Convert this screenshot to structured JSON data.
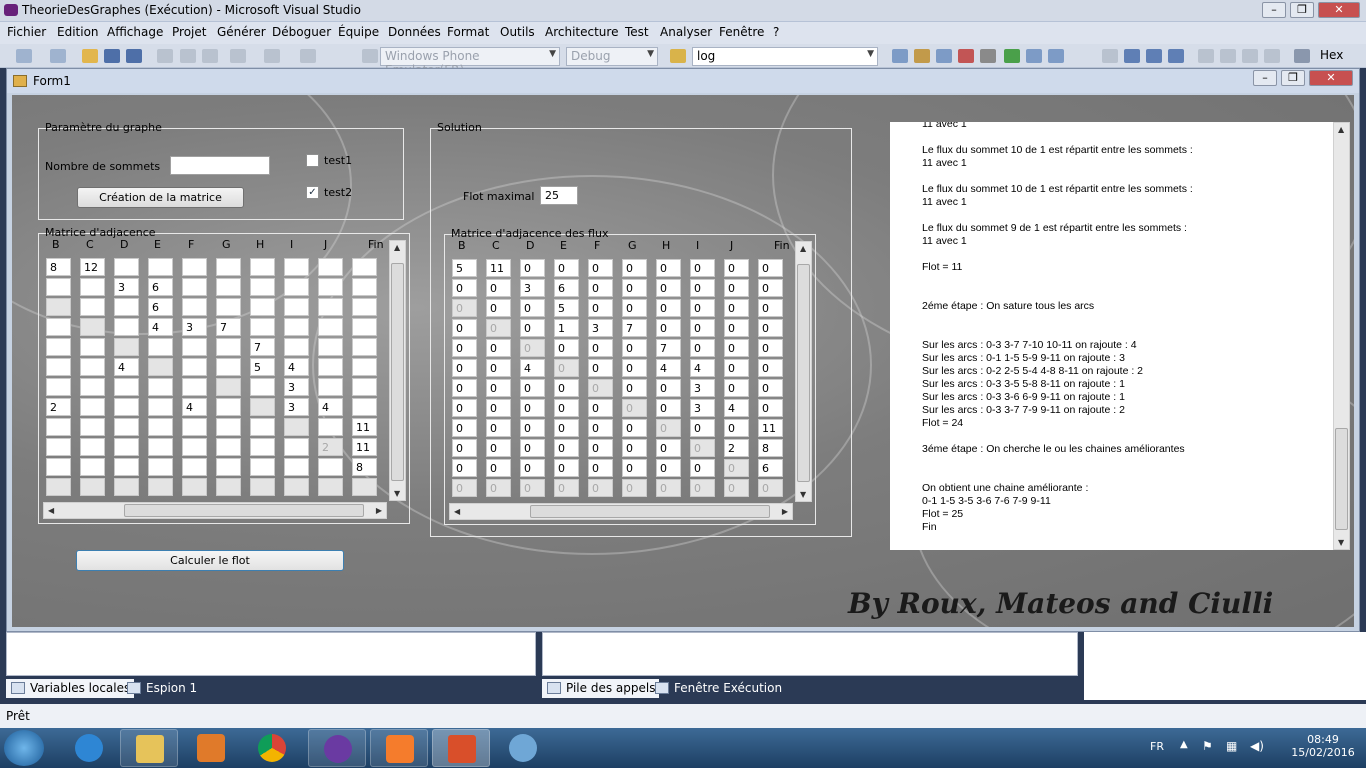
{
  "vs": {
    "title": "TheorieDesGraphes (Exécution) - Microsoft Visual Studio",
    "menu": [
      "Fichier",
      "Edition",
      "Affichage",
      "Projet",
      "Générer",
      "Déboguer",
      "Équipe",
      "Données",
      "Format",
      "Outils",
      "Architecture",
      "Test",
      "Analyser",
      "Fenêtre",
      "?"
    ],
    "emulator": "Windows Phone Emulator(FR)",
    "config": "Debug",
    "find": "log",
    "hex": "Hex"
  },
  "form": {
    "title": "Form1",
    "params": {
      "label": "Paramètre du graphe",
      "sommets_label": "Nombre de sommets",
      "sommets_value": "",
      "button": "Création de la matrice",
      "test1": "test1",
      "test2": "test2",
      "test1_checked": false,
      "test2_checked": true
    },
    "adj": {
      "label": "Matrice d'adjacence",
      "cols": [
        "B",
        "C",
        "D",
        "E",
        "F",
        "G",
        "H",
        "I",
        "J",
        "Fin"
      ],
      "rows": [
        [
          "8",
          "12",
          "",
          "",
          "",
          "",
          "",
          "",
          "",
          ""
        ],
        [
          "",
          "",
          "3",
          "6",
          "",
          "",
          "",
          "",
          "",
          ""
        ],
        [
          "",
          "",
          "",
          "6",
          "",
          "",
          "",
          "",
          "",
          ""
        ],
        [
          "",
          "",
          "",
          "4",
          "3",
          "7",
          "",
          "",
          "",
          ""
        ],
        [
          "",
          "",
          "",
          "",
          "",
          "",
          "7",
          "",
          "",
          ""
        ],
        [
          "",
          "",
          "4",
          "",
          "",
          "",
          "5",
          "4",
          "",
          ""
        ],
        [
          "",
          "",
          "",
          "",
          "",
          "",
          "",
          "3",
          "",
          ""
        ],
        [
          "2",
          "",
          "",
          "",
          "4",
          "",
          "",
          "3",
          "4",
          ""
        ],
        [
          "",
          "",
          "",
          "",
          "",
          "",
          "",
          "",
          "",
          "11"
        ],
        [
          "",
          "",
          "",
          "",
          "",
          "",
          "",
          "",
          "2",
          "11"
        ],
        [
          "",
          "",
          "",
          "",
          "",
          "",
          "",
          "",
          "",
          "8"
        ],
        [
          "",
          "",
          "",
          "",
          "",
          "",
          "",
          "",
          "",
          ""
        ]
      ],
      "disabled": [
        [
          2,
          0
        ],
        [
          3,
          1
        ],
        [
          4,
          2
        ],
        [
          5,
          3
        ],
        [
          6,
          5
        ],
        [
          7,
          6
        ],
        [
          8,
          7
        ],
        [
          9,
          8
        ],
        [
          11,
          0
        ],
        [
          11,
          1
        ],
        [
          11,
          2
        ],
        [
          11,
          3
        ],
        [
          11,
          4
        ],
        [
          11,
          5
        ],
        [
          11,
          6
        ],
        [
          11,
          7
        ],
        [
          11,
          8
        ],
        [
          11,
          9
        ]
      ]
    },
    "solution": {
      "label": "Solution",
      "flot_label": "Flot maximal",
      "flot_value": "25"
    },
    "flux": {
      "label": "Matrice d'adjacence des flux",
      "cols": [
        "B",
        "C",
        "D",
        "E",
        "F",
        "G",
        "H",
        "I",
        "J",
        "Fin"
      ],
      "rows": [
        [
          "5",
          "11",
          "0",
          "0",
          "0",
          "0",
          "0",
          "0",
          "0",
          "0"
        ],
        [
          "0",
          "0",
          "3",
          "6",
          "0",
          "0",
          "0",
          "0",
          "0",
          "0"
        ],
        [
          "0",
          "0",
          "0",
          "5",
          "0",
          "0",
          "0",
          "0",
          "0",
          "0"
        ],
        [
          "0",
          "0",
          "0",
          "1",
          "3",
          "7",
          "0",
          "0",
          "0",
          "0"
        ],
        [
          "0",
          "0",
          "0",
          "0",
          "0",
          "0",
          "7",
          "0",
          "0",
          "0"
        ],
        [
          "0",
          "0",
          "4",
          "0",
          "0",
          "0",
          "4",
          "4",
          "0",
          "0"
        ],
        [
          "0",
          "0",
          "0",
          "0",
          "0",
          "0",
          "0",
          "3",
          "0",
          "0"
        ],
        [
          "0",
          "0",
          "0",
          "0",
          "0",
          "0",
          "0",
          "3",
          "4",
          "0"
        ],
        [
          "0",
          "0",
          "0",
          "0",
          "0",
          "0",
          "0",
          "0",
          "0",
          "11"
        ],
        [
          "0",
          "0",
          "0",
          "0",
          "0",
          "0",
          "0",
          "0",
          "2",
          "8"
        ],
        [
          "0",
          "0",
          "0",
          "0",
          "0",
          "0",
          "0",
          "0",
          "0",
          "6"
        ],
        [
          "0",
          "0",
          "0",
          "0",
          "0",
          "0",
          "0",
          "0",
          "0",
          "0"
        ]
      ],
      "disabled": [
        [
          2,
          0
        ],
        [
          3,
          1
        ],
        [
          4,
          2
        ],
        [
          5,
          3
        ],
        [
          6,
          4
        ],
        [
          7,
          5
        ],
        [
          8,
          6
        ],
        [
          9,
          7
        ],
        [
          10,
          8
        ],
        [
          11,
          0
        ],
        [
          11,
          1
        ],
        [
          11,
          2
        ],
        [
          11,
          3
        ],
        [
          11,
          4
        ],
        [
          11,
          5
        ],
        [
          11,
          6
        ],
        [
          11,
          7
        ],
        [
          11,
          8
        ],
        [
          11,
          9
        ]
      ]
    },
    "calc_button": "Calculer le flot",
    "log": [
      "11 avec 1",
      "",
      "Le flux du sommet 10 de 1 est répartit entre les sommets :",
      "11 avec 1",
      "",
      "Le flux du sommet 10 de 1 est répartit entre les sommets :",
      "11 avec 1",
      "",
      "Le flux du sommet 9 de 1 est répartit entre les sommets :",
      "11 avec 1",
      "",
      "Flot = 11",
      "",
      "",
      "2éme étape : On sature tous les arcs",
      "",
      "",
      "Sur les arcs : 0-3 3-7 7-10 10-11  on rajoute : 4",
      "Sur les arcs : 0-1 1-5 5-9 9-11  on rajoute : 3",
      "Sur les arcs : 0-2 2-5 5-4 4-8 8-11  on rajoute : 2",
      "Sur les arcs : 0-3 3-5 5-8 8-11  on rajoute : 1",
      "Sur les arcs : 0-3 3-6 6-9 9-11  on rajoute : 1",
      "Sur les arcs : 0-3 3-7 7-9 9-11  on rajoute : 2",
      "Flot = 24",
      "",
      "3éme étape : On cherche le ou les chaines améliorantes",
      "",
      "",
      "On obtient une chaine améliorante :",
      "0-1 1-5 3-5 3-6 7-6 7-9 9-11",
      "Flot = 25",
      "Fin"
    ],
    "signature": "By Roux, Mateos and Ciulli"
  },
  "bottom": {
    "tabs_left": [
      "Variables locales",
      "Espion 1"
    ],
    "tabs_right": [
      "Pile des appels",
      "Fenêtre Exécution"
    ]
  },
  "status": "Prêt",
  "taskbar": {
    "lang": "FR",
    "time": "08:49",
    "date": "15/02/2016"
  }
}
